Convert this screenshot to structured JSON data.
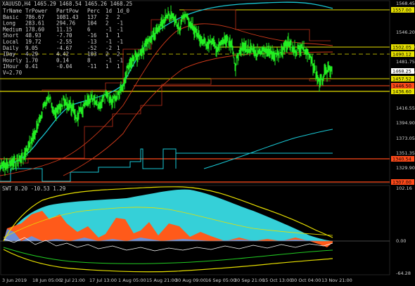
{
  "colors": {
    "background": "#000000",
    "price": "#22ee22",
    "ma_cyan": "#19c9d6",
    "ma_red": "#d23a1a",
    "level_yellow": "#e6e000",
    "level_red": "#ff4a1a",
    "swt_fill_cyan": "#35d0d8",
    "swt_fill_orange": "#ff5a1a",
    "swt_fill_blue": "#6f8fd6",
    "swt_yellow": "#e8e000",
    "swt_green": "#22cc22",
    "grid": "#2a2a2a"
  },
  "header": {
    "symbol_line": "XAUUSD,H4  1465.29 1468.54 1465.26 1468.25"
  },
  "stats_table": {
    "columns": [
      "TrName",
      "TrPower",
      "PartPow",
      "Perc",
      "1d",
      "1d_0"
    ],
    "rows": [
      [
        "Basic",
        "786.67",
        "1081.43",
        "137",
        "2",
        "2"
      ],
      [
        "Long",
        "283.61",
        "294.76",
        "104",
        "2",
        "-1"
      ],
      [
        "Medium",
        "178.60",
        "11.15",
        "6",
        "-1",
        "-1"
      ],
      [
        "Short",
        "48.93",
        "-7.70",
        "-16",
        "1",
        "1"
      ],
      [
        "Local",
        "19.72",
        "-2.55",
        "-13",
        "-1",
        "-1"
      ],
      [
        "Daily",
        "9.05",
        "-4.67",
        "-52",
        "-2",
        "1"
      ],
      [
        "IDay",
        "4.29",
        "4.42",
        "103",
        "2",
        "2"
      ],
      [
        "Hourly",
        "1.70",
        "0.14",
        "8",
        "-1",
        "-1"
      ],
      [
        "IHour",
        "0.41",
        "-0.04",
        "-11",
        "1",
        "1"
      ]
    ],
    "footer": "V=2.70"
  },
  "price_axis": {
    "ticks": [
      "1568.45",
      "1546.20",
      "1524.90",
      "1481.75",
      "1459.90",
      "1416.55",
      "1394.90",
      "1373.05",
      "1351.35",
      "1329.90"
    ],
    "labels": [
      {
        "text": "1557.00",
        "color": "#e6e000"
      },
      {
        "text": "1502.05",
        "color": "#e6e000"
      },
      {
        "text": "1490.12",
        "color": "#e6e000"
      },
      {
        "text": "1468.25",
        "color": "#d0d0d0"
      },
      {
        "text": "1457.52",
        "color": "#e6e000"
      },
      {
        "text": "1446.50",
        "color": "#ff4a1a"
      },
      {
        "text": "1436.60",
        "color": "#e6e000"
      },
      {
        "text": "1340.54",
        "color": "#ff4a1a"
      },
      {
        "text": "1307.00",
        "color": "#ff4a1a"
      }
    ]
  },
  "indicator": {
    "title": "SWT 8.20 -10.53 1.29",
    "axis_ticks": [
      "102.16",
      "0.00",
      "-64.28"
    ]
  },
  "time_axis": {
    "labels": [
      "3 Jun 2019",
      "18 Jun 05:00",
      "2 Jul 21:00",
      "17 Jul 13:00",
      "1 Aug 05:00",
      "15 Aug 21:00",
      "30 Aug 09:00",
      "16 Sep 05:00",
      "30 Sep 21:00",
      "15 Oct 13:00",
      "30 Oct 04:00",
      "13 Nov 21:00"
    ]
  }
}
